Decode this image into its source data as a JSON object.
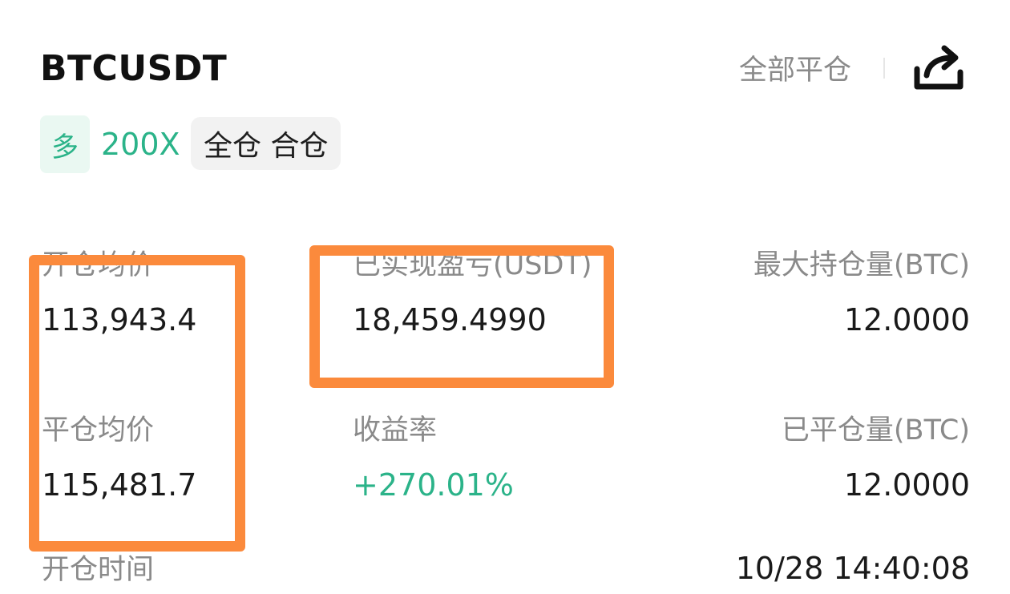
{
  "header": {
    "symbol": "BTCUSDT",
    "close_all_label": "全部平仓",
    "share_icon": "share-icon"
  },
  "tags": {
    "direction": "多",
    "leverage": "200X",
    "margin_mode": "全仓 合仓"
  },
  "stats": {
    "open_avg_price_label": "开仓均价",
    "open_avg_price_value": "113,943.4",
    "realized_pnl_label": "已实现盈亏(USDT)",
    "realized_pnl_value": "18,459.4990",
    "max_position_label": "最大持仓量(BTC)",
    "max_position_value": "12.0000",
    "close_avg_price_label": "平仓均价",
    "close_avg_price_value": "115,481.7",
    "roi_label": "收益率",
    "roi_value": "+270.01%",
    "closed_volume_label": "已平仓量(BTC)",
    "closed_volume_value": "12.0000",
    "open_time_label": "开仓时间",
    "open_time_value": "10/28 14:40:08"
  },
  "colors": {
    "accent_green": "#2bb389",
    "highlight_orange": "#fb8a3c",
    "muted_text": "#8a8a8a"
  }
}
